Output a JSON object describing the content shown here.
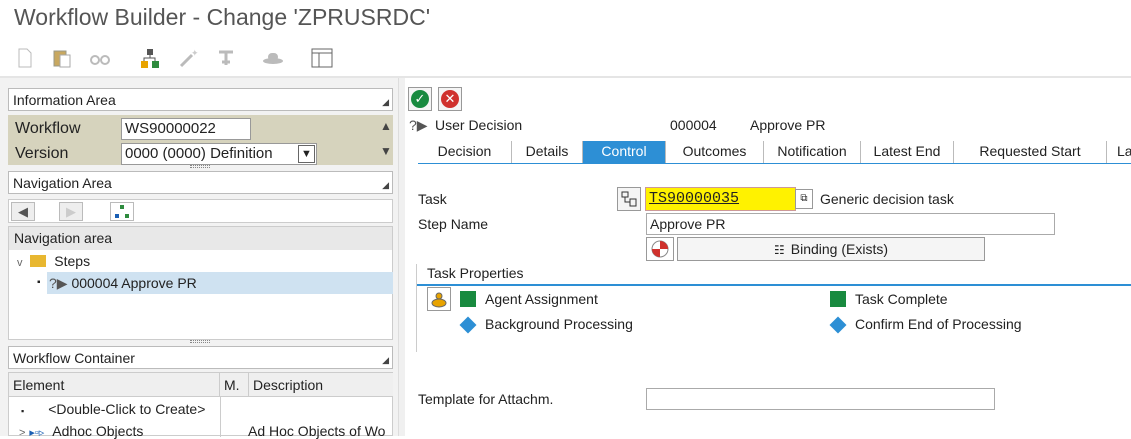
{
  "window": {
    "title": "Workflow Builder - Change 'ZPRUSRDC'"
  },
  "toolbar": {
    "icons": [
      "new-document-icon",
      "paste-icon",
      "glasses-icon",
      "org-structure-icon",
      "magic-wand-icon",
      "anchor-icon",
      "hat-icon",
      "layout-icon"
    ]
  },
  "info_area": {
    "title": "Information Area",
    "workflow_label": "Workflow",
    "workflow_value": "WS90000022",
    "version_label": "Version",
    "version_value": "0000 (0000) Definition"
  },
  "navigation_area": {
    "title": "Navigation Area",
    "tree_header": "Navigation area",
    "steps_label": "Steps",
    "step_prefix": "?▶",
    "step_item": "000004 Approve PR"
  },
  "workflow_container": {
    "title": "Workflow Container",
    "columns": [
      "Element",
      "M.",
      "Description"
    ],
    "rows": [
      {
        "element": "<Double-Click to Create>",
        "m": "",
        "description": ""
      },
      {
        "element": "Adhoc Objects",
        "m": "",
        "description": "Ad Hoc Objects of Wo"
      }
    ]
  },
  "step_header": {
    "prefix": "?▶",
    "type": "User Decision",
    "number": "000004",
    "name": "Approve PR"
  },
  "tabs": [
    {
      "label": "Decision",
      "active": false
    },
    {
      "label": "Details",
      "active": false
    },
    {
      "label": "Control",
      "active": true
    },
    {
      "label": "Outcomes",
      "active": false
    },
    {
      "label": "Notification",
      "active": false
    },
    {
      "label": "Latest End",
      "active": false
    },
    {
      "label": "Requested Start",
      "active": false
    },
    {
      "label": "La",
      "active": false
    }
  ],
  "control": {
    "task_label": "Task",
    "task_value": "TS90000035",
    "task_description": "Generic decision task",
    "step_name_label": "Step Name",
    "step_name_value": "Approve PR",
    "binding_label": "Binding (Exists)",
    "task_properties_title": "Task Properties",
    "properties": {
      "agent_assignment": "Agent Assignment",
      "task_complete": "Task Complete",
      "background_processing": "Background Processing",
      "confirm_end": "Confirm End of Processing"
    },
    "template_label": "Template for Attachm.",
    "template_value": ""
  },
  "colors": {
    "accent": "#2d8fd5",
    "ok_green": "#188a3f",
    "cancel_red": "#d0312d",
    "task_highlight": "#fff200",
    "info_bg": "#d6d3bd"
  }
}
